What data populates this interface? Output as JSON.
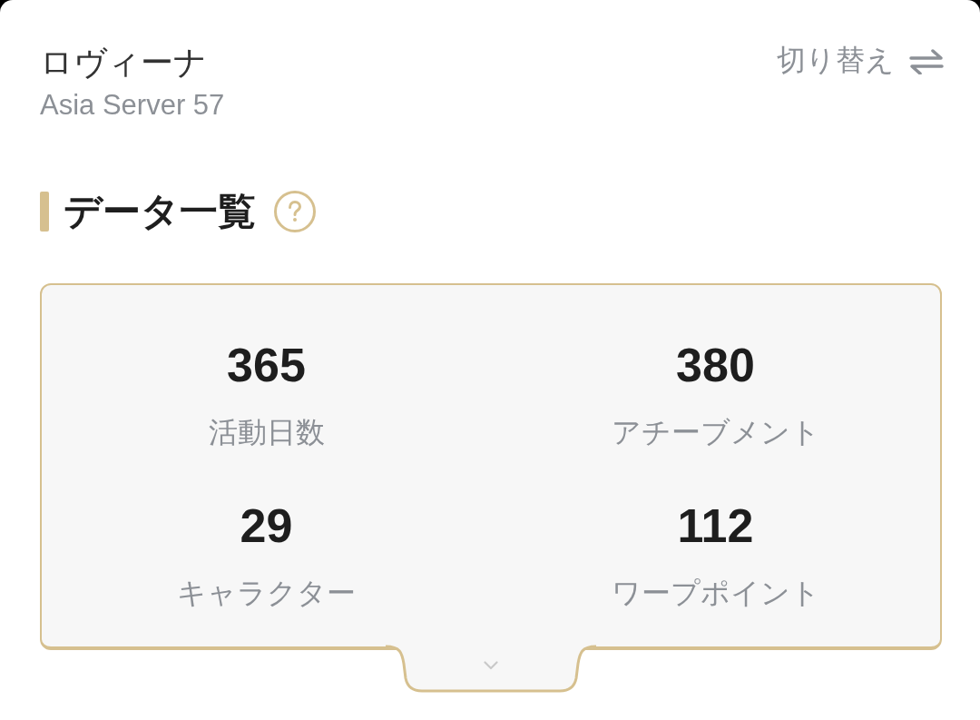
{
  "account": {
    "name": "ロヴィーナ",
    "server": "Asia Server 57",
    "switch_label": "切り替え"
  },
  "section": {
    "title": "データ一覧"
  },
  "stats": [
    {
      "value": "365",
      "label": "活動日数"
    },
    {
      "value": "380",
      "label": "アチーブメント"
    },
    {
      "value": "29",
      "label": "キャラクター"
    },
    {
      "value": "112",
      "label": "ワープポイント"
    }
  ]
}
